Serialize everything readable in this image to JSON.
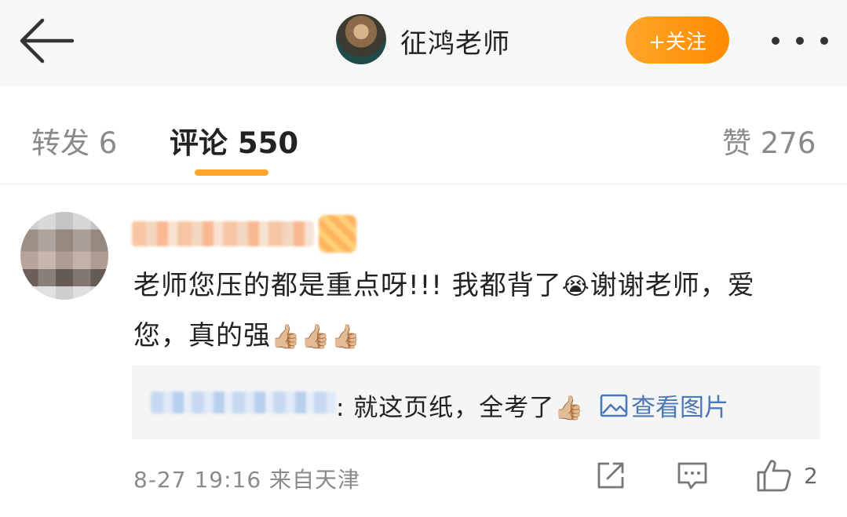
{
  "header": {
    "name": "征鸿老师",
    "follow_label": "+关注"
  },
  "tabs": {
    "repost_label": "转发 6",
    "comment_label": "评论 550",
    "like_label": "赞 276"
  },
  "comment": {
    "text_part1": "老师您压的都是重点呀!!! 我都背了",
    "emoji_cry": "😭",
    "text_part2": "谢谢老师，爱您，真的强",
    "emoji_thumbs": "👍🏼👍🏼👍🏼",
    "reply": {
      "text": ": 就这页纸，全考了",
      "emoji": "👍🏼",
      "view_picture_label": "查看图片"
    },
    "meta": "8-27 19:16 来自天津",
    "like_count": "2"
  },
  "icons": {
    "back": "arrow-left-icon",
    "more": "more-dots-icon",
    "picture": "picture-icon",
    "share": "share-icon",
    "comment": "comment-icon",
    "like": "thumbs-up-icon"
  },
  "colors": {
    "accent_orange": "#ff9a1f",
    "link_blue": "#4a78b8",
    "header_bg": "#f7f7f7"
  }
}
